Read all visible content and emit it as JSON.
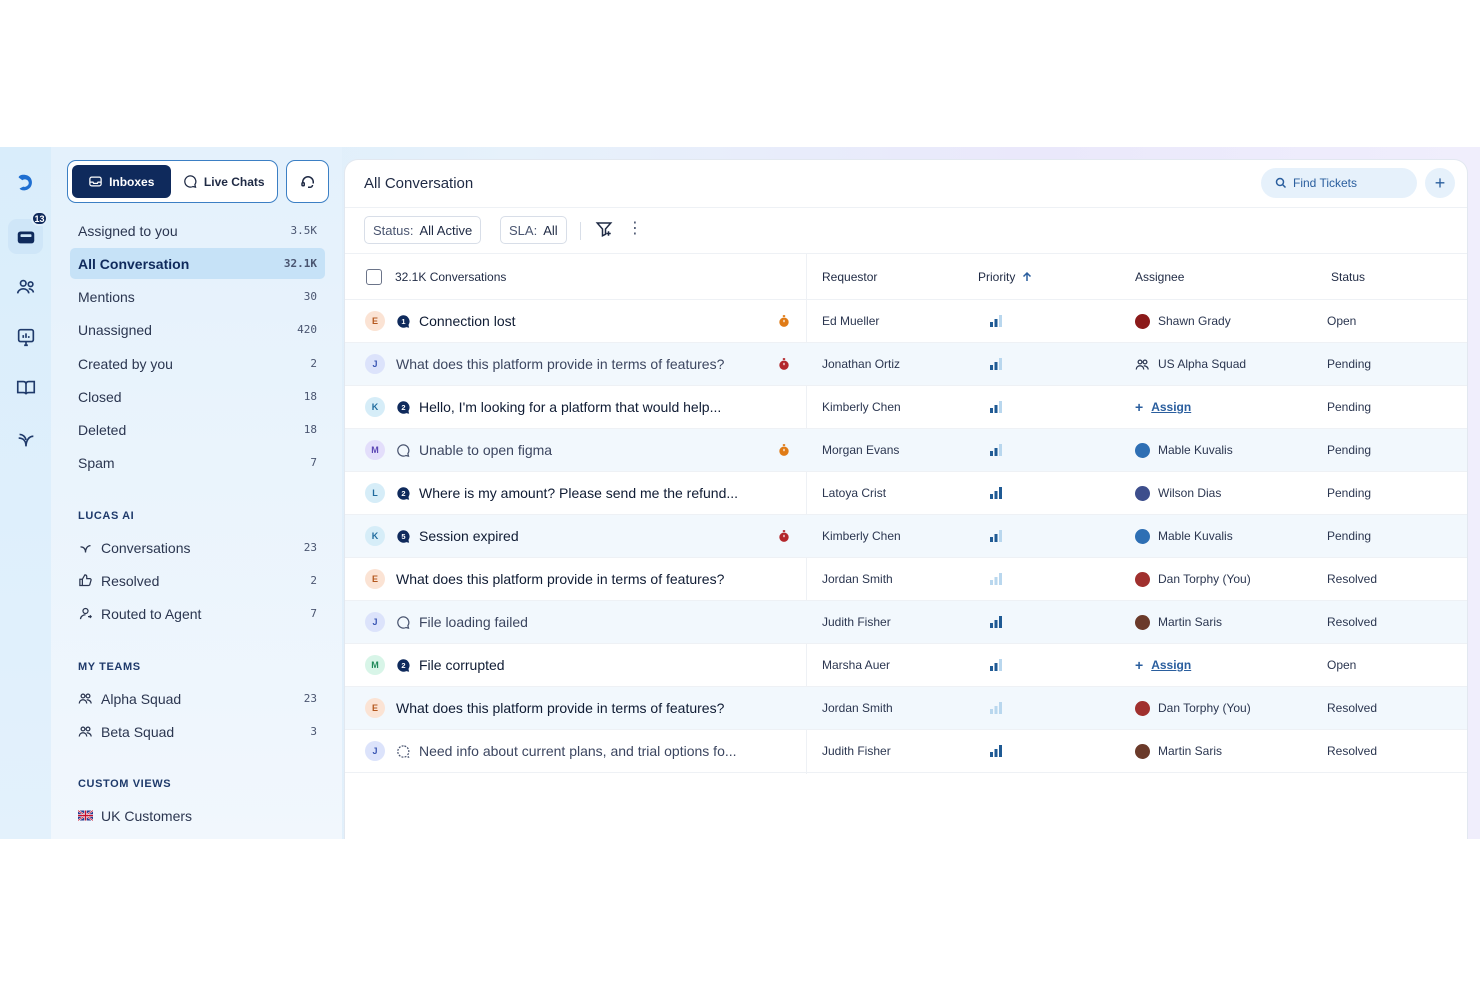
{
  "rail": {
    "items": [
      {
        "icon": "logo-icon"
      },
      {
        "icon": "inbox-icon",
        "badge": "13",
        "active": true
      },
      {
        "icon": "users-icon"
      },
      {
        "icon": "reports-icon"
      },
      {
        "icon": "knowledge-book-icon"
      },
      {
        "icon": "ai-sparkle-icon"
      }
    ]
  },
  "sidebar": {
    "toggle": {
      "inboxes": "Inboxes",
      "live_chats": "Live Chats"
    },
    "nav": [
      {
        "label": "Assigned to you",
        "count": "3.5K"
      },
      {
        "label": "All Conversation",
        "count": "32.1K",
        "active": true
      },
      {
        "label": "Mentions",
        "count": "30"
      },
      {
        "label": "Unassigned",
        "count": "420"
      },
      {
        "label": "Created by you",
        "count": "2"
      },
      {
        "label": "Closed",
        "count": "18"
      },
      {
        "label": "Deleted",
        "count": "18"
      },
      {
        "label": "Spam",
        "count": "7"
      }
    ],
    "lucas_ai": {
      "title": "LUCAS AI",
      "items": [
        {
          "label": "Conversations",
          "count": "23",
          "icon": "sparkle-icon"
        },
        {
          "label": "Resolved",
          "count": "2",
          "icon": "thumbs-up-icon"
        },
        {
          "label": "Routed to Agent",
          "count": "7",
          "icon": "agent-icon"
        }
      ]
    },
    "my_teams": {
      "title": "MY TEAMS",
      "items": [
        {
          "label": "Alpha Squad",
          "count": "23"
        },
        {
          "label": "Beta Squad",
          "count": "3"
        }
      ]
    },
    "custom_views": {
      "title": "CUSTOM VIEWS",
      "items": [
        {
          "label": "UK Customers"
        }
      ]
    }
  },
  "main": {
    "title": "All Conversation",
    "find_placeholder": "Find Tickets",
    "add_label": "+",
    "filters": {
      "status_label": "Status:",
      "status_value": "All Active",
      "sla_label": "SLA:",
      "sla_value": "All"
    },
    "columns": {
      "conversations": "32.1K Conversations",
      "requestor": "Requestor",
      "priority": "Priority",
      "assignee": "Assignee",
      "status": "Status"
    },
    "rows": [
      {
        "initial": "E",
        "channel": "1",
        "subject": "Connection lost",
        "style": "bold",
        "timer": "#e07b16",
        "requestor": "Ed Mueller",
        "priority": 2,
        "assignee": "Shawn Grady",
        "assignee_color": "#8b1a1a",
        "status": "Open"
      },
      {
        "initial": "J",
        "channel": "",
        "subject": "What does this platform provide in terms of features?",
        "style": "muted",
        "timer": "#b3262b",
        "requestor": "Jonathan Ortiz",
        "priority": 2,
        "assignee": "US Alpha Squad",
        "assignee_type": "team",
        "status": "Pending"
      },
      {
        "initial": "K",
        "channel": "2",
        "subject": "Hello, I'm looking for a platform that would help...",
        "style": "bold",
        "timer": "",
        "requestor": "Kimberly Chen",
        "priority": 2,
        "assignee": "Assign",
        "assignee_type": "assign",
        "status": "Pending"
      },
      {
        "initial": "M",
        "channel": "chat",
        "subject": "Unable to open figma",
        "style": "muted",
        "timer": "#e07b16",
        "requestor": "Morgan Evans",
        "priority": 2,
        "assignee": "Mable Kuvalis",
        "assignee_color": "#2e6fb4",
        "status": "Pending"
      },
      {
        "initial": "L",
        "channel": "2",
        "subject": "Where is my amount? Please send me the refund...",
        "style": "bold",
        "timer": "",
        "requestor": "Latoya Crist",
        "priority": 3,
        "assignee": "Wilson Dias",
        "assignee_color": "#3d4e8c",
        "status": "Pending"
      },
      {
        "initial": "K",
        "channel": "5",
        "subject": "Session expired",
        "style": "bold",
        "timer": "#b3262b",
        "requestor": "Kimberly Chen",
        "priority": 2,
        "assignee": "Mable Kuvalis",
        "assignee_color": "#2e6fb4",
        "status": "Pending"
      },
      {
        "initial": "E",
        "channel": "",
        "subject": "What does this platform provide in terms of features?",
        "style": "bold",
        "timer": "",
        "requestor": "Jordan Smith",
        "priority": 1,
        "assignee": "Dan Torphy (You)",
        "assignee_color": "#a0302e",
        "status": "Resolved"
      },
      {
        "initial": "J",
        "channel": "chat",
        "subject": "File loading failed",
        "style": "muted",
        "timer": "",
        "requestor": "Judith Fisher",
        "priority": 3,
        "assignee": "Martin Saris",
        "assignee_color": "#6b3a2a",
        "status": "Resolved"
      },
      {
        "initial": "M",
        "channel": "2",
        "subject": "File corrupted",
        "style": "bold",
        "timer": "",
        "requestor": "Marsha Auer",
        "priority": 2,
        "assignee": "Assign",
        "assignee_type": "assign",
        "status": "Open"
      },
      {
        "initial": "E",
        "channel": "",
        "subject": "What does this platform provide in terms of features?",
        "style": "bold",
        "timer": "",
        "requestor": "Jordan Smith",
        "priority": 1,
        "assignee": "Dan Torphy (You)",
        "assignee_color": "#a0302e",
        "status": "Resolved"
      },
      {
        "initial": "J",
        "channel": "dashed",
        "subject": "Need info about current plans, and trial options fo...",
        "style": "muted",
        "timer": "",
        "requestor": "Judith Fisher",
        "priority": 3,
        "assignee": "Martin Saris",
        "assignee_color": "#6b3a2a",
        "status": "Resolved"
      }
    ]
  }
}
